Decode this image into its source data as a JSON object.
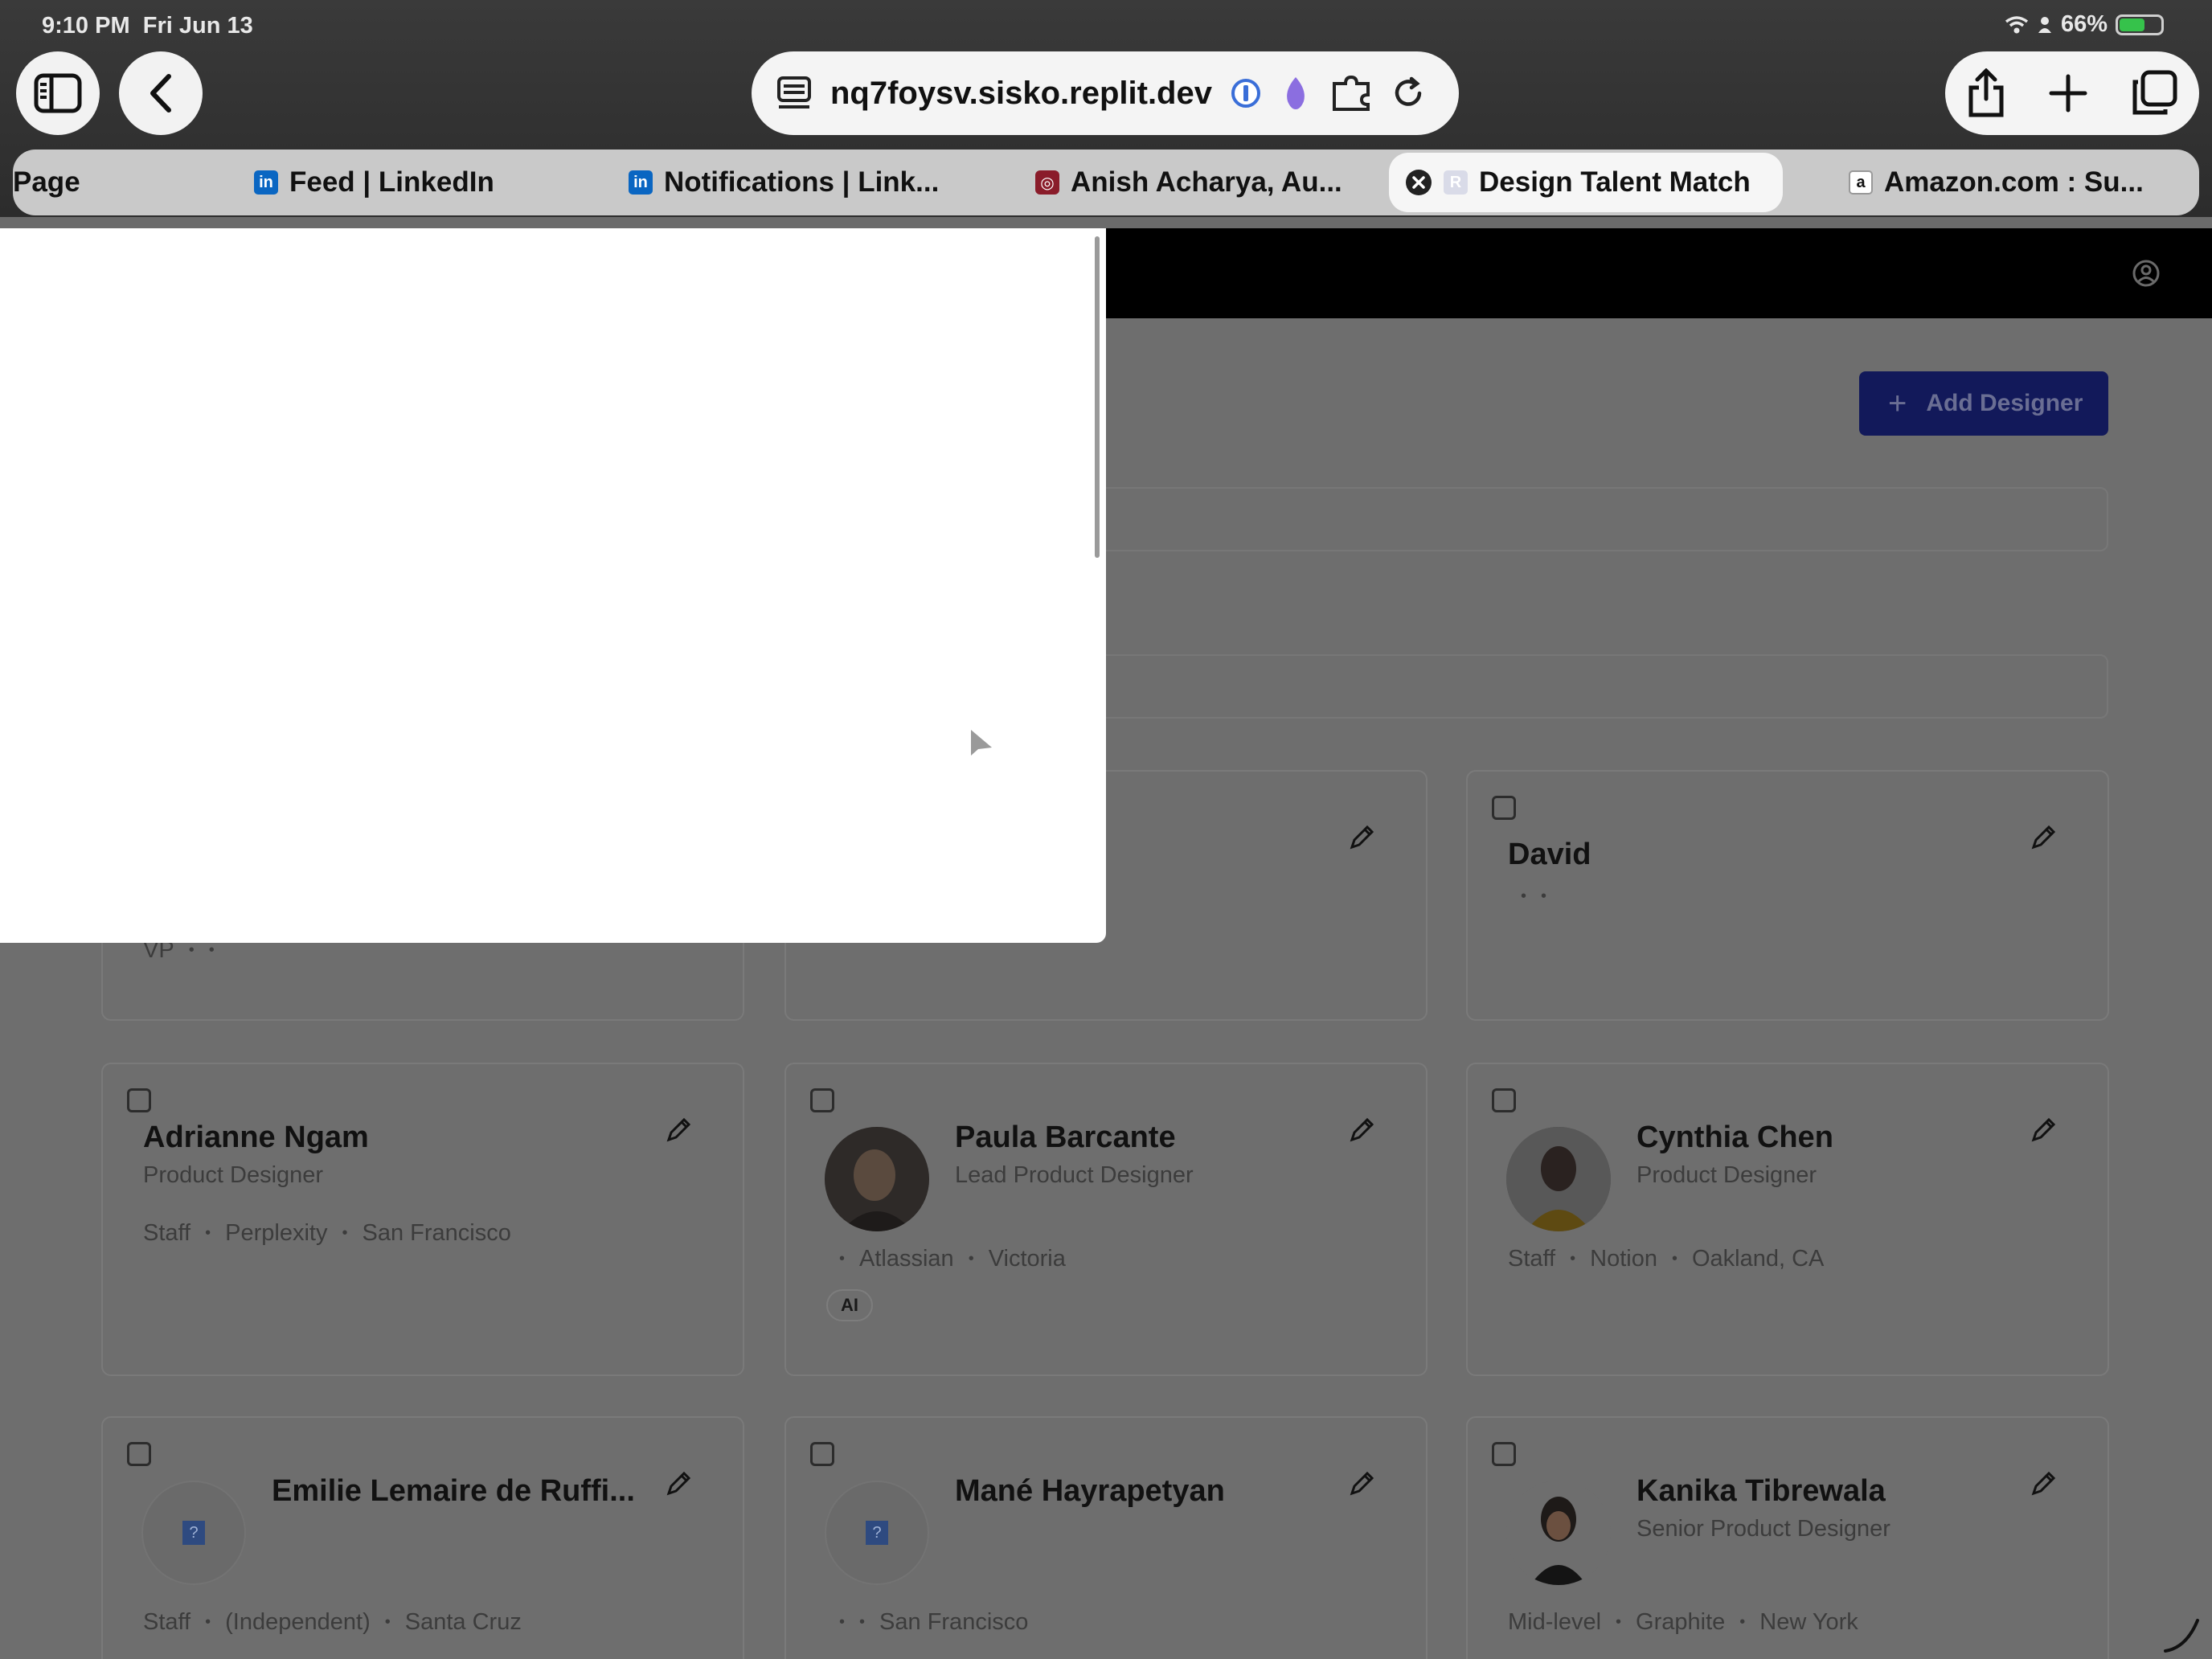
{
  "status_bar": {
    "time": "9:10 PM",
    "date": "Fri Jun 13",
    "battery": "66%"
  },
  "address_bar": {
    "url": "nq7foysv.sisko.replit.dev"
  },
  "tabs": [
    {
      "label": "Page",
      "favicon": ""
    },
    {
      "label": "Feed | LinkedIn",
      "favicon": "in"
    },
    {
      "label": "Notifications | Link...",
      "favicon": "in"
    },
    {
      "label": "Anish Acharya, Au...",
      "favicon": ""
    },
    {
      "label": "Design Talent Match",
      "favicon": "R",
      "active": true
    },
    {
      "label": "Amazon.com : Su...",
      "favicon": "a"
    }
  ],
  "app": {
    "add_button": "Add Designer"
  },
  "cards": [
    {
      "name": "",
      "role": "",
      "meta": [
        "VP",
        "",
        ""
      ],
      "tags": []
    },
    {
      "name": "",
      "role": "",
      "meta": [],
      "tags": []
    },
    {
      "name": "David",
      "role": "",
      "meta": [
        "",
        "",
        ""
      ],
      "tags": []
    },
    {
      "name": "Adrianne Ngam",
      "role": "Product Designer",
      "meta": [
        "Staff",
        "Perplexity",
        "San Francisco"
      ],
      "tags": []
    },
    {
      "name": "Paula Barcante",
      "role": "Lead Product Designer",
      "meta": [
        "",
        "Atlassian",
        "Victoria"
      ],
      "tags": [
        "AI"
      ]
    },
    {
      "name": "Cynthia Chen",
      "role": "Product Designer",
      "meta": [
        "Staff",
        "Notion",
        "Oakland, CA"
      ],
      "tags": []
    },
    {
      "name": "Emilie Lemaire de Ruffi...",
      "role": "",
      "meta": [
        "Staff",
        "(Independent)",
        "Santa Cruz"
      ],
      "tags": []
    },
    {
      "name": "Mané Hayrapetyan",
      "role": "",
      "meta": [
        "",
        "",
        "San Francisco"
      ],
      "tags": []
    },
    {
      "name": "Kanika Tibrewala",
      "role": "Senior Product Designer",
      "meta": [
        "Mid-level",
        "Graphite",
        "New York"
      ],
      "tags": []
    }
  ],
  "colors": {
    "primary_button": "#12195a",
    "overlay": "#6e6e6e",
    "header": "#000000"
  }
}
